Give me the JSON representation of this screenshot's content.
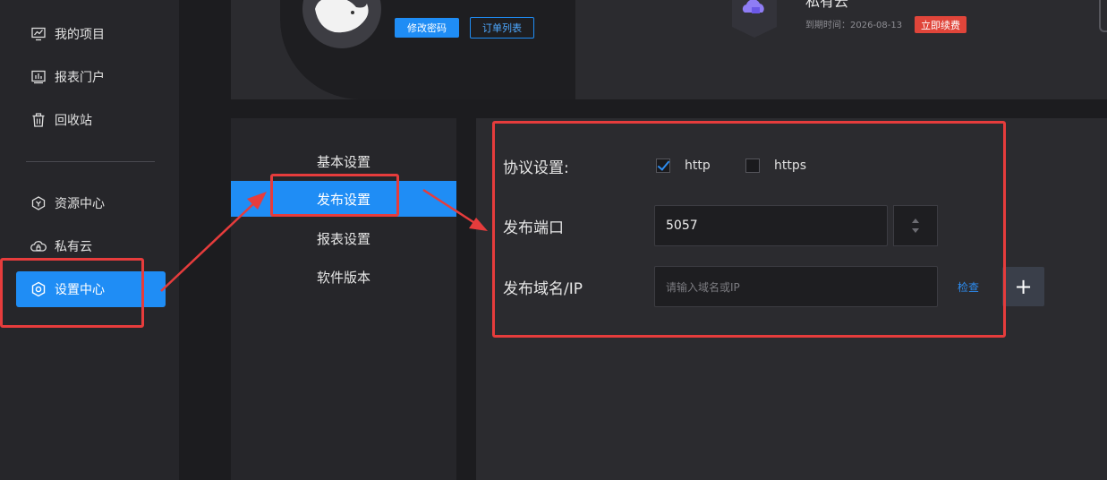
{
  "sidebar": {
    "items": [
      {
        "label": "我的项目",
        "icon": "project-chart-icon"
      },
      {
        "label": "报表门户",
        "icon": "report-portal-icon"
      },
      {
        "label": "回收站",
        "icon": "trash-icon"
      },
      {
        "label": "资源中心",
        "icon": "resource-hex-icon"
      },
      {
        "label": "私有云",
        "icon": "private-cloud-icon"
      },
      {
        "label": "设置中心",
        "icon": "gear-icon",
        "active": true
      }
    ]
  },
  "header": {
    "change_password_label": "修改密码",
    "order_list_label": "订单列表",
    "cloud_title": "私有云",
    "expire_label": "到期时间：2026-08-13",
    "renew_label": "立即续费"
  },
  "settings_nav": {
    "items": [
      {
        "label": "基本设置"
      },
      {
        "label": "发布设置",
        "active": true
      },
      {
        "label": "报表设置"
      },
      {
        "label": "软件版本"
      }
    ]
  },
  "publish_settings": {
    "protocol_label": "协议设置:",
    "http_label": "http",
    "http_checked": true,
    "https_label": "https",
    "https_checked": false,
    "port_label": "发布端口",
    "port_value": "5057",
    "domain_label": "发布域名/IP",
    "domain_placeholder": "请输入域名或IP",
    "check_label": "检查",
    "add_symbol": "+"
  },
  "colors": {
    "accent": "#1f8df5",
    "highlight_annotation": "#e63c3c",
    "renew_badge": "#e0453a"
  }
}
